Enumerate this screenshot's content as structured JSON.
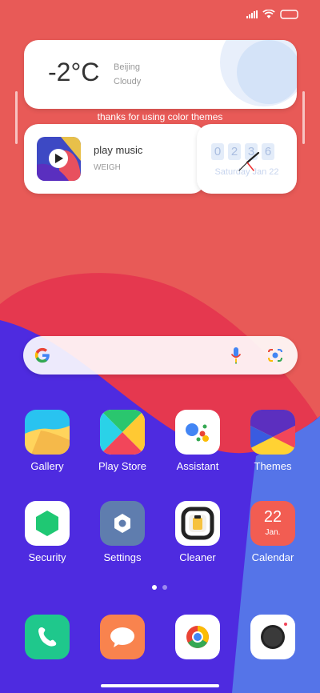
{
  "colors": {
    "background_top": "#e85a57",
    "background_red": "#e5384f",
    "background_blue": "#4e2be0",
    "background_blue2": "#5574e8"
  },
  "status_bar": {
    "icons": [
      "signal-icon",
      "wifi-icon",
      "battery-icon"
    ]
  },
  "weather": {
    "temperature": "-2°C",
    "city": "Beijing",
    "condition": "Cloudy"
  },
  "theme_text": "thanks for using color themes",
  "music": {
    "title": "play music",
    "subtitle": "WEIGH"
  },
  "clock": {
    "digits": [
      "0",
      "2",
      "3",
      "6"
    ],
    "date_text": "Saturday Jan 22"
  },
  "search": {
    "mic_icon": "mic-icon",
    "lens_icon": "lens-icon"
  },
  "apps_row1": [
    {
      "label": "Gallery",
      "icon": "gallery-icon"
    },
    {
      "label": "Play Store",
      "icon": "play-store-icon"
    },
    {
      "label": "Assistant",
      "icon": "assistant-icon"
    },
    {
      "label": "Themes",
      "icon": "themes-icon"
    }
  ],
  "apps_row2": [
    {
      "label": "Security",
      "icon": "security-icon"
    },
    {
      "label": "Settings",
      "icon": "settings-icon"
    },
    {
      "label": "Cleaner",
      "icon": "cleaner-icon"
    },
    {
      "label": "Calendar",
      "icon": "calendar-icon",
      "day": "22",
      "month": "Jan."
    }
  ],
  "dock": [
    {
      "icon": "phone-icon"
    },
    {
      "icon": "messages-icon"
    },
    {
      "icon": "chrome-icon"
    },
    {
      "icon": "camera-icon"
    }
  ],
  "page_indicator": {
    "total": 2,
    "active": 1
  }
}
